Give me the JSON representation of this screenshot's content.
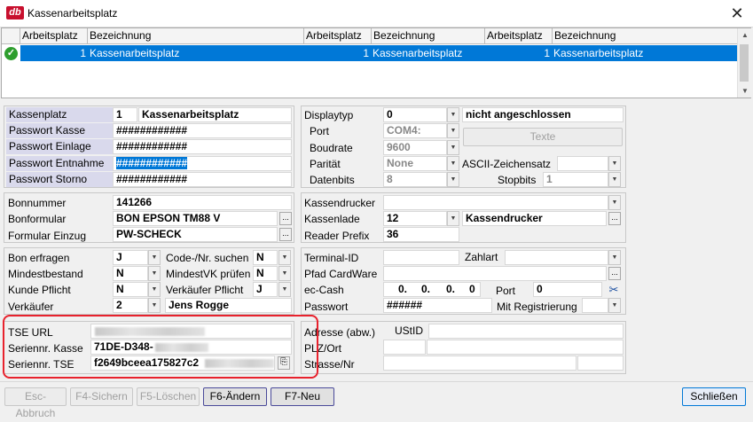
{
  "window": {
    "title": "Kassenarbeitsplatz",
    "logo": "db",
    "close": "✕"
  },
  "grid": {
    "headers": [
      "Arbeitsplatz",
      "Bezeichnung",
      "Arbeitsplatz",
      "Bezeichnung",
      "Arbeitsplatz",
      "Bezeichnung"
    ],
    "row": [
      "1",
      "Kassenarbeitsplatz",
      "1",
      "Kassenarbeitsplatz",
      "1",
      "Kassenarbeitsplatz"
    ]
  },
  "kasse": {
    "kassenplatz_label": "Kassenplatz",
    "kassenplatz_nr": "1",
    "kassenplatz_name": "Kassenarbeitsplatz",
    "pw_kasse_label": "Passwort Kasse",
    "pw_kasse": "############",
    "pw_einlage_label": "Passwort Einlage",
    "pw_einlage": "############",
    "pw_entnahme_label": "Passwort Entnahme",
    "pw_entnahme": "############",
    "pw_storno_label": "Passwort Storno",
    "pw_storno": "############"
  },
  "display": {
    "typ_label": "Displaytyp",
    "typ": "0",
    "typ_status": "nicht angeschlossen",
    "port_label": "Port",
    "port": "COM4:",
    "test_btn": "Texte",
    "baud_label": "Boudrate",
    "baud": "9600",
    "paritaet_label": "Parität",
    "paritaet": "None",
    "ascii_label": "ASCII-Zeichensatz",
    "datenbits_label": "Datenbits",
    "datenbits": "8",
    "stopbits_label": "Stopbits",
    "stopbits": "1"
  },
  "bon": {
    "bonnummer_label": "Bonnummer",
    "bonnummer": "141266",
    "bonformular_label": "Bonformular",
    "bonformular": "BON EPSON TM88 V",
    "formular_einzug_label": "Formular Einzug",
    "formular_einzug": "PW-SCHECK"
  },
  "drucker": {
    "kassendrucker_label": "Kassendrucker",
    "kassenlade_label": "Kassenlade",
    "kassenlade": "12",
    "kassenlade_name": "Kassendrucker",
    "reader_label": "Reader Prefix",
    "reader": "36"
  },
  "optionen": {
    "bon_erfragen_label": "Bon erfragen",
    "bon_erfragen": "J",
    "code_suchen_label": "Code-/Nr. suchen",
    "code_suchen": "N",
    "mindestbestand_label": "Mindestbestand",
    "mindestbestand": "N",
    "mindestvk_label": "MindestVK prüfen",
    "mindestvk": "N",
    "kunde_label": "Kunde Pflicht",
    "kunde": "N",
    "verkaeufer_pflicht_label": "Verkäufer Pflicht",
    "verkaeufer_pflicht": "J",
    "verkaeufer_label": "Verkäufer",
    "verkaeufer": "2",
    "verkaeufer_name": "Jens Rogge"
  },
  "terminal": {
    "terminal_label": "Terminal-ID",
    "zahlart_label": "Zahlart",
    "cardware_label": "Pfad CardWare",
    "eccash_label": "ec-Cash",
    "ip": [
      "0.",
      "0.",
      "0.",
      "0"
    ],
    "port_label": "Port",
    "port": "0",
    "passwort_label": "Passwort",
    "passwort": "######",
    "registrierung": "Mit Registrierung"
  },
  "tse": {
    "url_label": "TSE URL",
    "kasse_label": "Seriennr. Kasse",
    "kasse_value": "71DE-D348-",
    "tse_label": "Seriennr. TSE",
    "tse_value": "f2649bceea175827c2"
  },
  "adresse": {
    "label": "Adresse (abw.)",
    "ustid": "UStID",
    "plz_label": "PLZ/Ort",
    "strasse_label": "Strasse/Nr"
  },
  "buttons": {
    "abbruch": "Esc-Abbruch",
    "sichern": "F4-Sichern",
    "loeschen": "F5-Löschen",
    "aendern": "F6-Ändern",
    "neu": "F7-Neu",
    "schliessen": "Schließen"
  }
}
